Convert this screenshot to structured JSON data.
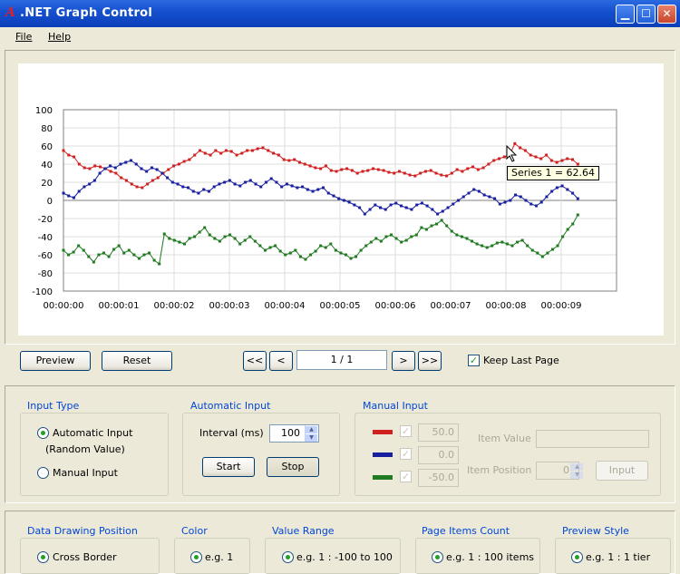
{
  "window": {
    "logo": "A",
    "title": ".NET Graph Control"
  },
  "menu": {
    "file": "File",
    "help": "Help"
  },
  "toolbar": {
    "preview": "Preview",
    "reset": "Reset",
    "first": "<<",
    "prev": "<",
    "page": "1  /  1",
    "next": ">",
    "last": ">>",
    "keep_last_page": "Keep Last Page",
    "keep_last_page_checked": true
  },
  "tooltip": "Series 1 = 62.64",
  "chart_data": {
    "type": "line",
    "ylim": [
      -100,
      100
    ],
    "yticks": [
      "100",
      "80",
      "60",
      "40",
      "20",
      "0",
      "-20",
      "-40",
      "-60",
      "-80",
      "-100"
    ],
    "xticks": [
      "00:00:00",
      "00:00:01",
      "00:00:02",
      "00:00:03",
      "00:00:04",
      "00:00:05",
      "00:00:06",
      "00:00:07",
      "00:00:08",
      "00:00:09"
    ],
    "xlim": [
      0,
      10
    ],
    "grid": true,
    "series": [
      {
        "color": "#d02020",
        "values": [
          55,
          50,
          48,
          40,
          36,
          35,
          38,
          37,
          35,
          32,
          30,
          25,
          22,
          18,
          15,
          14,
          18,
          22,
          25,
          30,
          34,
          38,
          40,
          43,
          45,
          50,
          55,
          52,
          50,
          55,
          52,
          55,
          54,
          50,
          52,
          55,
          55,
          57,
          58,
          55,
          52,
          50,
          45,
          44,
          45,
          42,
          40,
          38,
          36,
          35,
          38,
          33,
          32,
          34,
          35,
          33,
          30,
          32,
          33,
          35,
          34,
          33,
          31,
          30,
          32,
          30,
          28,
          27,
          30,
          32,
          33,
          30,
          28,
          27,
          30,
          34,
          32,
          35,
          37,
          34,
          36,
          40,
          44,
          46,
          48,
          50,
          62.64,
          58,
          55,
          50,
          48,
          46,
          50,
          44,
          42,
          44,
          46,
          45,
          40
        ]
      },
      {
        "color": "#1820a0",
        "values": [
          8,
          5,
          3,
          10,
          15,
          18,
          22,
          30,
          35,
          38,
          36,
          40,
          42,
          44,
          40,
          35,
          32,
          36,
          34,
          30,
          25,
          20,
          18,
          15,
          14,
          10,
          8,
          12,
          10,
          15,
          18,
          20,
          22,
          18,
          16,
          20,
          22,
          18,
          15,
          20,
          24,
          20,
          15,
          18,
          16,
          14,
          15,
          12,
          10,
          12,
          14,
          8,
          5,
          2,
          0,
          -2,
          -5,
          -8,
          -15,
          -10,
          -5,
          -8,
          -10,
          -5,
          -3,
          -6,
          -8,
          -10,
          -5,
          -3,
          -6,
          -10,
          -15,
          -12,
          -8,
          -4,
          0,
          4,
          8,
          12,
          10,
          6,
          4,
          2,
          -4,
          -2,
          0,
          6,
          4,
          0,
          -4,
          -6,
          -2,
          4,
          10,
          14,
          16,
          12,
          8,
          2
        ]
      },
      {
        "color": "#207a20",
        "values": [
          -55,
          -60,
          -57,
          -50,
          -55,
          -62,
          -68,
          -60,
          -58,
          -62,
          -54,
          -50,
          -58,
          -55,
          -60,
          -64,
          -60,
          -58,
          -66,
          -70,
          -37,
          -42,
          -44,
          -46,
          -48,
          -42,
          -40,
          -35,
          -30,
          -38,
          -42,
          -45,
          -40,
          -38,
          -42,
          -48,
          -44,
          -40,
          -45,
          -50,
          -55,
          -52,
          -50,
          -56,
          -60,
          -58,
          -55,
          -62,
          -65,
          -60,
          -56,
          -50,
          -52,
          -48,
          -55,
          -58,
          -60,
          -64,
          -62,
          -55,
          -50,
          -46,
          -42,
          -45,
          -40,
          -38,
          -42,
          -46,
          -44,
          -40,
          -38,
          -30,
          -32,
          -28,
          -26,
          -22,
          -28,
          -34,
          -38,
          -40,
          -42,
          -45,
          -48,
          -50,
          -52,
          -50,
          -47,
          -46,
          -48,
          -50,
          -46,
          -44,
          -50,
          -55,
          -58,
          -62,
          -58,
          -54,
          -50,
          -40,
          -32,
          -26,
          -16
        ]
      }
    ]
  },
  "input_type": {
    "label": "Input Type",
    "auto_label": "Automatic Input",
    "auto_sub": "(Random Value)",
    "manual_label": "Manual Input"
  },
  "auto_input": {
    "label": "Automatic Input",
    "interval_label": "Interval (ms)",
    "interval_value": "100",
    "start": "Start",
    "stop": "Stop"
  },
  "manual_input": {
    "label": "Manual Input",
    "rows": [
      {
        "color": "#d02020",
        "value": "50.0"
      },
      {
        "color": "#1820a0",
        "value": "0.0"
      },
      {
        "color": "#207a20",
        "value": "-50.0"
      }
    ],
    "item_value_label": "Item Value",
    "item_position_label": "Item Position",
    "item_position_value": "0",
    "input_button": "Input"
  },
  "settings": {
    "data_drawing": {
      "label": "Data Drawing Position",
      "option": "Cross Border"
    },
    "color": {
      "label": "Color",
      "option": "e.g. 1"
    },
    "value_range": {
      "label": "Value Range",
      "option": "e.g. 1 : -100 to 100"
    },
    "page_items": {
      "label": "Page Items Count",
      "option": "e.g. 1 : 100 items"
    },
    "preview_style": {
      "label": "Preview Style",
      "option": "e.g. 1 : 1 tier"
    }
  }
}
